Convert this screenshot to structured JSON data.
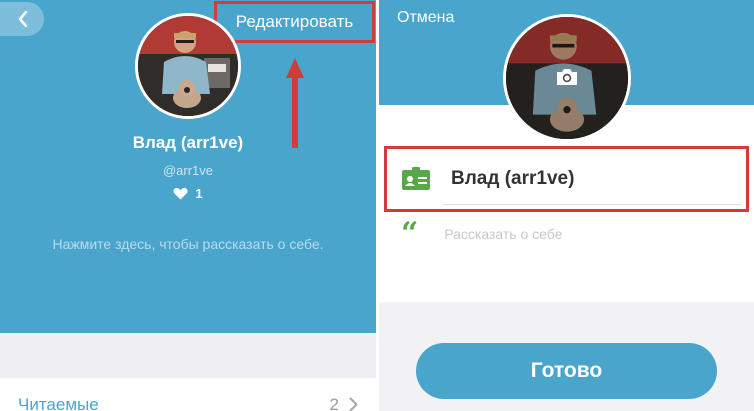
{
  "profile_view": {
    "edit_label": "Редактировать",
    "user_name": "Влад (arr1ve)",
    "user_handle": "@arr1ve",
    "likes_count": "1",
    "bio_prompt": "Нажмите здесь, чтобы рассказать о себе.",
    "list_item": {
      "label": "Читаемые",
      "count": "2"
    }
  },
  "edit_view": {
    "cancel_label": "Отмена",
    "name_value": "Влад (arr1ve)",
    "bio_placeholder": "Рассказать о себе",
    "done_label": "Готово"
  },
  "colors": {
    "accent": "#4aa5cd",
    "highlight": "#d23b3b",
    "field_icon": "#58a84a"
  },
  "icons": [
    "chevron-left-icon",
    "heart-icon",
    "camera-icon",
    "id-card-icon",
    "quote-icon",
    "chevron-right-icon"
  ]
}
